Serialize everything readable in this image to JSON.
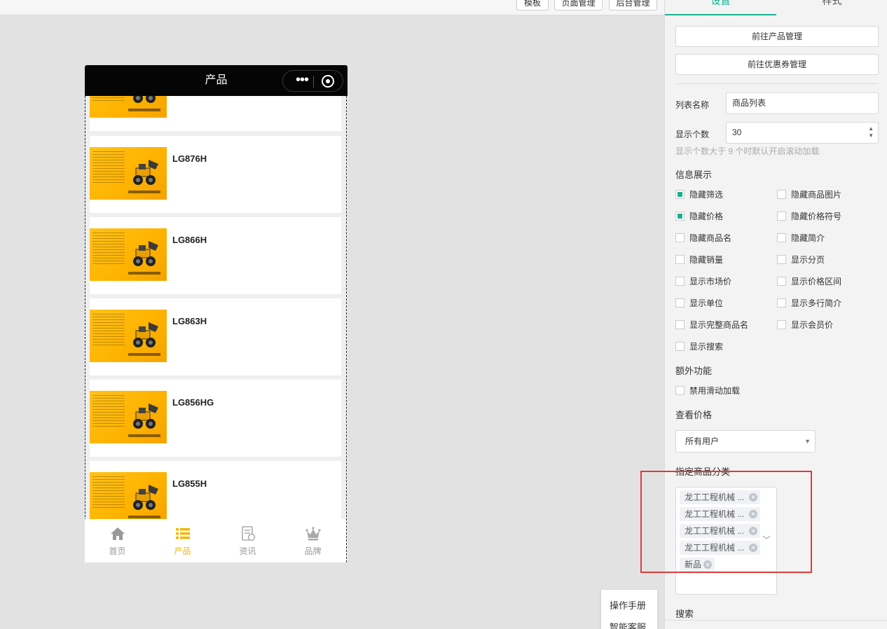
{
  "toolbar": {
    "buttons": [
      "模板",
      "页面管理",
      "后台管理"
    ]
  },
  "phone": {
    "title": "产品",
    "menu_icon": "more-dots-icon",
    "close_icon": "target-circle-icon",
    "products": [
      {
        "name": ""
      },
      {
        "name": "LG876H"
      },
      {
        "name": "LG866H"
      },
      {
        "name": "LG863H"
      },
      {
        "name": "LG856HG"
      },
      {
        "name": "LG855H"
      }
    ],
    "tabbar": [
      {
        "label": "首页",
        "icon": "home-icon",
        "active": false
      },
      {
        "label": "产品",
        "icon": "list-icon",
        "active": true
      },
      {
        "label": "资讯",
        "icon": "news-icon",
        "active": false
      },
      {
        "label": "品牌",
        "icon": "crown-icon",
        "active": false
      }
    ]
  },
  "helper": {
    "manual": "操作手册",
    "service": "智能客服"
  },
  "panel": {
    "tabs": [
      "设置",
      "样式"
    ],
    "goto_product": "前往产品管理",
    "goto_coupon": "前往优惠券管理",
    "list_name_label": "列表名称",
    "list_name_value": "商品列表",
    "count_label": "显示个数",
    "count_value": "30",
    "count_hint": "显示个数大于 9 个时默认开启滚动加载",
    "info_title": "信息展示",
    "info_options": [
      {
        "label": "隐藏筛选",
        "checked": true
      },
      {
        "label": "隐藏商品图片",
        "checked": false
      },
      {
        "label": "隐藏价格",
        "checked": true
      },
      {
        "label": "隐藏价格符号",
        "checked": false
      },
      {
        "label": "隐藏商品名",
        "checked": false
      },
      {
        "label": "隐藏简介",
        "checked": false
      },
      {
        "label": "隐藏销量",
        "checked": false
      },
      {
        "label": "显示分页",
        "checked": false
      },
      {
        "label": "显示市场价",
        "checked": false
      },
      {
        "label": "显示价格区间",
        "checked": false
      },
      {
        "label": "显示单位",
        "checked": false
      },
      {
        "label": "显示多行简介",
        "checked": false
      },
      {
        "label": "显示完整商品名",
        "checked": false
      },
      {
        "label": "显示会员价",
        "checked": false
      },
      {
        "label": "显示搜索",
        "checked": false
      }
    ],
    "extra_title": "额外功能",
    "extra_options": [
      {
        "label": "禁用滑动加载",
        "checked": false
      }
    ],
    "price_title": "查看价格",
    "price_select": "所有用户",
    "category_title": "指定商品分类",
    "category_tags": [
      "龙工工程机械 ...",
      "龙工工程机械 ...",
      "龙工工程机械 ...",
      "龙工工程机械 ...",
      "新品"
    ],
    "search_title": "搜索"
  },
  "colors": {
    "accent": "#16b28f",
    "tab_active": "#f2b705",
    "highlight_box": "#e03a3a",
    "header": "#050505"
  }
}
